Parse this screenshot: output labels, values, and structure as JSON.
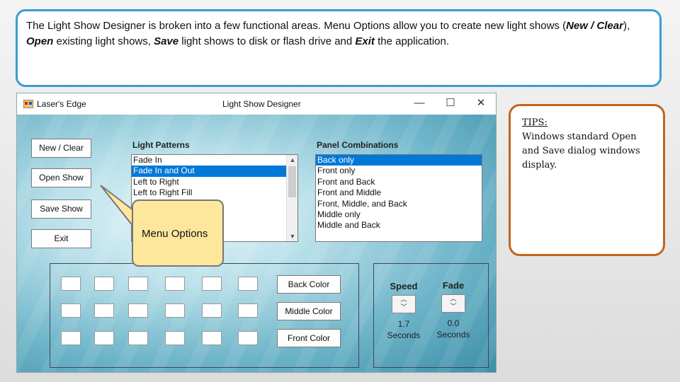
{
  "intro": {
    "part1": "The Light Show Designer is broken into a few functional areas.  Menu Options allow you to create new light shows (",
    "new_clear": "New / Clear",
    "part2": "), ",
    "open": "Open",
    "part3": " existing light shows, ",
    "save": "Save",
    "part4": " light shows to disk or flash drive and ",
    "exit": "Exit",
    "part5": " the application."
  },
  "window": {
    "app_name": "Laser's Edge",
    "title": "Light Show Designer",
    "minimize": "—",
    "maximize": "☐",
    "close": "✕"
  },
  "menu": {
    "new_clear": "New / Clear",
    "open_show": "Open Show",
    "save_show": "Save Show",
    "exit": "Exit"
  },
  "light_patterns": {
    "label": "Light Patterns",
    "items": [
      "Fade In",
      "Fade In and Out",
      "Left to Right",
      "Left to Right Fill"
    ],
    "selected_index": 1
  },
  "panel_combinations": {
    "label": "Panel Combinations",
    "items": [
      "Back only",
      "Front only",
      "Front and Back",
      "Front and Middle",
      "Front, Middle, and Back",
      "Middle only",
      "Middle and Back"
    ],
    "selected_index": 0
  },
  "colors": {
    "back": "Back Color",
    "middle": "Middle Color",
    "front": "Front Color"
  },
  "speed": {
    "label": "Speed",
    "value": "1.7",
    "unit": "Seconds"
  },
  "fade": {
    "label": "Fade",
    "value": "0.0",
    "unit": "Seconds"
  },
  "callout": {
    "text": "Menu Options"
  },
  "tips": {
    "heading": "TIPS:",
    "body": "Windows standard Open and Save dialog windows display."
  },
  "accent_colors": {
    "intro_border": "#3d9bd3",
    "tips_border": "#c0651f",
    "callout_fill": "#fde79d",
    "selection": "#0078d7"
  }
}
